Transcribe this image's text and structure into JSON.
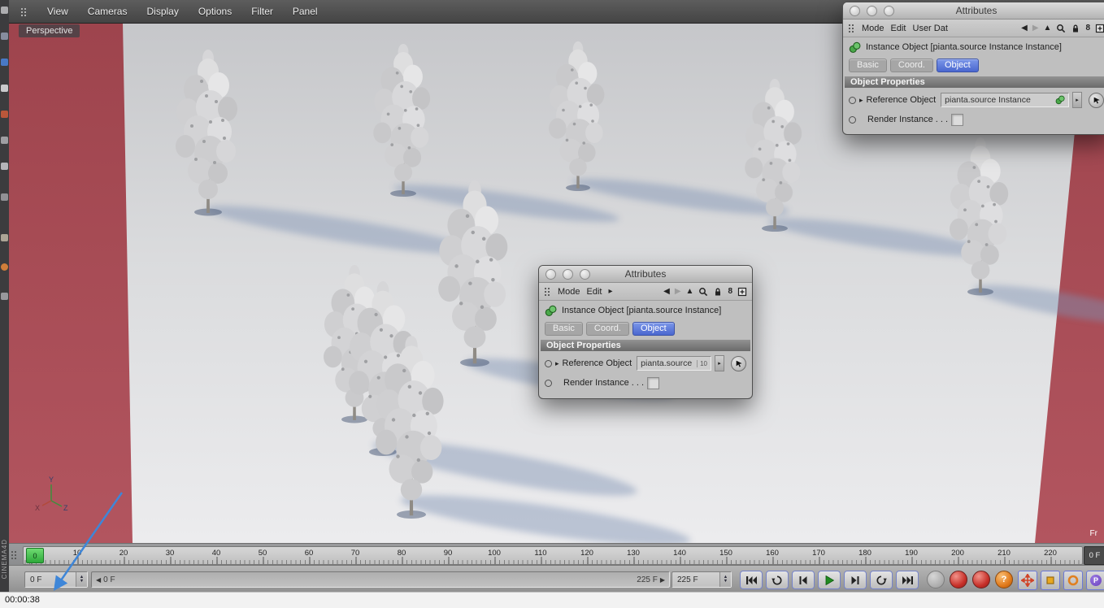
{
  "app": {
    "brand_vertical": "CINEMA4D"
  },
  "menu_bar": {
    "items": [
      "View",
      "Cameras",
      "Display",
      "Options",
      "Filter",
      "Panel"
    ]
  },
  "viewport": {
    "camera_label": "Perspective",
    "hud_frame_label": "Fr",
    "axis": {
      "x": "X",
      "y": "Y",
      "z": "Z"
    }
  },
  "icons": {
    "back": "◀",
    "forward": "▶",
    "up": "▲",
    "expand": "▸",
    "overflow": "▸",
    "figure8": "8",
    "question": "?",
    "param": "P",
    "slider_left": "◀",
    "slider_right": "▶",
    "stepper_up": "▲",
    "stepper_down": "▼",
    "link_menu": "▸"
  },
  "attributes_top": {
    "title": "Attributes",
    "menus": [
      "Mode",
      "Edit",
      "User Dat"
    ],
    "object_label": "Instance Object [pianta.source Instance Instance]",
    "tabs": [
      "Basic",
      "Coord.",
      "Object"
    ],
    "selected_tab": "Object",
    "section_header": "Object Properties",
    "reference_label": "Reference Object",
    "reference_value": "pianta.source Instance",
    "render_instance_label": "Render Instance . . ."
  },
  "attributes_mid": {
    "title": "Attributes",
    "menus": [
      "Mode",
      "Edit"
    ],
    "object_label": "Instance Object [pianta.source Instance]",
    "tabs": [
      "Basic",
      "Coord.",
      "Object"
    ],
    "selected_tab": "Object",
    "section_header": "Object Properties",
    "reference_label": "Reference Object",
    "reference_value": "pianta.source",
    "reference_spinner": "10",
    "render_instance_label": "Render Instance . . ."
  },
  "timeline": {
    "marker_label": "0",
    "tick_labels": [
      "10",
      "20",
      "30",
      "40",
      "50",
      "60",
      "70",
      "80",
      "90",
      "100",
      "110",
      "120",
      "130",
      "140",
      "150",
      "160",
      "170",
      "180",
      "190",
      "200",
      "210",
      "220"
    ],
    "end_frame_box": "0 F"
  },
  "transport": {
    "current_frame": "0 F",
    "slider_start": "0 F",
    "slider_end": "225 F",
    "range_end": "225 F"
  },
  "recording_overlay": {
    "timestamp": "00:00:38"
  }
}
